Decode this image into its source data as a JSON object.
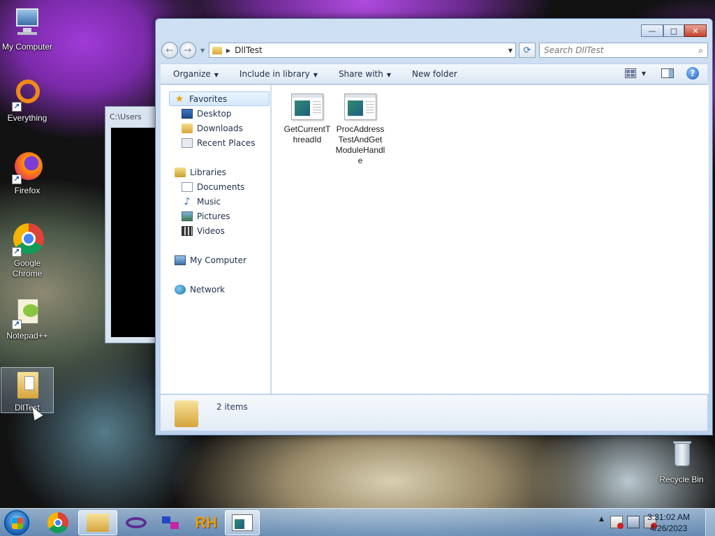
{
  "desktop": {
    "icons": [
      {
        "label": "My Computer"
      },
      {
        "label": "Everything"
      },
      {
        "label": "Firefox"
      },
      {
        "label": "Google Chrome"
      },
      {
        "label": "Notepad++"
      },
      {
        "label": "DllTest"
      },
      {
        "label": "Recycle Bin"
      }
    ],
    "shortcut_glyph": "↗"
  },
  "console_window": {
    "title": "C:\\Users"
  },
  "explorer": {
    "caption": {
      "minimize": "—",
      "maximize": "□",
      "close": "✕"
    },
    "nav": {
      "back": "←",
      "forward": "→",
      "dropdown": "▼"
    },
    "address": {
      "arrow": "▶",
      "path": "DllTest",
      "dropdown": "▼"
    },
    "refresh_glyph": "⟳",
    "search": {
      "placeholder": "Search DllTest",
      "glyph": "⌕"
    },
    "toolbar": {
      "organize": "Organize",
      "include_in_library": "Include in library",
      "share_with": "Share with",
      "new_folder": "New folder",
      "caret": "▼",
      "help": "?"
    },
    "nav_pane": {
      "favorites": "Favorites",
      "desktop": "Desktop",
      "downloads": "Downloads",
      "recent_places": "Recent Places",
      "libraries": "Libraries",
      "documents": "Documents",
      "music": "Music",
      "pictures": "Pictures",
      "videos": "Videos",
      "my_computer": "My Computer",
      "network": "Network",
      "star_glyph": "★",
      "music_glyph": "♪"
    },
    "files": [
      {
        "name": "GetCurrentThreadId"
      },
      {
        "name": "ProcAddressTestAndGetModuleHandle"
      }
    ],
    "status": {
      "count": "2 items"
    }
  },
  "taskbar": {
    "clock_time": "3:31:02 AM",
    "clock_date": "4/26/2023",
    "tray_expand": "▲",
    "rh_label": "RH"
  },
  "colors": {
    "accent": "#1f6bc0",
    "window_frame": "#bcd2ec",
    "close_button": "#c4412b"
  }
}
